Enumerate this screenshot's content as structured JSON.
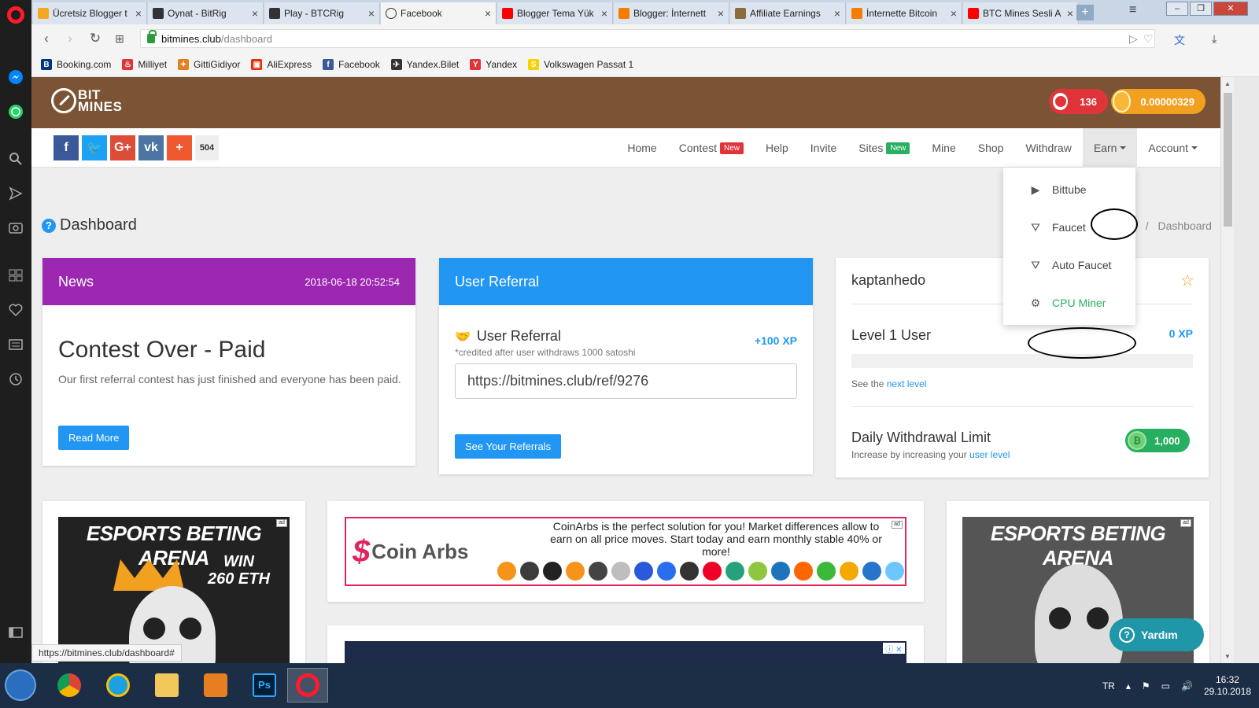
{
  "browser": {
    "tabs": [
      {
        "label": "Ücretsiz Blogger t",
        "color": "#f5a623"
      },
      {
        "label": "Oynat - BitRig",
        "color": "#333333"
      },
      {
        "label": "Play - BTCRig",
        "color": "#333333"
      },
      {
        "label": "Facebook",
        "color": "#ffffff"
      },
      {
        "label": "Blogger Tema Yük",
        "color": "#ff0000"
      },
      {
        "label": "Blogger: İnternett",
        "color": "#f57d00"
      },
      {
        "label": "Affiliate Earnings",
        "color": "#8a6d3b"
      },
      {
        "label": "İnternette Bitcoin",
        "color": "#f57d00"
      },
      {
        "label": "BTC Mines Sesli A",
        "color": "#ff0000"
      }
    ],
    "url_host": "bitmines.club",
    "url_path": "/dashboard",
    "bookmarks": [
      {
        "label": "Booking.com",
        "icon_text": "B",
        "color": "#003580"
      },
      {
        "label": "Milliyet",
        "icon_text": "♨",
        "color": "#e0343b"
      },
      {
        "label": "GittiGidiyor",
        "icon_text": "✦",
        "color": "#e67e22"
      },
      {
        "label": "AliExpress",
        "icon_text": "▣",
        "color": "#e62e04"
      },
      {
        "label": "Facebook",
        "icon_text": "f",
        "color": "#3b5998"
      },
      {
        "label": "Yandex.Bilet",
        "icon_text": "✈",
        "color": "#333333"
      },
      {
        "label": "Yandex",
        "icon_text": "Y",
        "color": "#e0343b"
      },
      {
        "label": "Volkswagen Passat 1",
        "icon_text": "S",
        "color": "#f7d100"
      }
    ],
    "status_url": "https://bitmines.club/dashboard#"
  },
  "site": {
    "logo_line1": "BIT",
    "logo_line2": "MINES",
    "energy": "136",
    "balance": "0.00000329",
    "share_count": "504",
    "social": [
      {
        "icon": "facebook-icon",
        "glyph": "f",
        "color": "#3b5998"
      },
      {
        "icon": "twitter-icon",
        "glyph": "🐦",
        "color": "#1da1f2"
      },
      {
        "icon": "google-plus-icon",
        "glyph": "G+",
        "color": "#dd4b39"
      },
      {
        "icon": "vk-icon",
        "glyph": "vk",
        "color": "#4c75a3"
      },
      {
        "icon": "share-plus-icon",
        "glyph": "+",
        "color": "#f0582f"
      }
    ],
    "nav": {
      "home": "Home",
      "contest": "Contest",
      "contest_badge": "New",
      "help": "Help",
      "invite": "Invite",
      "sites": "Sites",
      "sites_badge": "New",
      "mine": "Mine",
      "shop": "Shop",
      "withdraw": "Withdraw",
      "earn": "Earn",
      "account": "Account"
    },
    "earn_menu": [
      {
        "label": "Bittube",
        "icon": "play-icon",
        "glyph": "▶"
      },
      {
        "label": "Faucet",
        "icon": "faucet-icon",
        "glyph": "⛛"
      },
      {
        "label": "Auto Faucet",
        "icon": "auto-faucet-icon",
        "glyph": "⛛"
      },
      {
        "label": "CPU Miner",
        "icon": "gears-icon",
        "glyph": "⚙"
      }
    ],
    "page_title": "Dashboard",
    "breadcrumb_home": "e",
    "breadcrumb_sep": "/",
    "breadcrumb_current": "Dashboard"
  },
  "news": {
    "header": "News",
    "date": "2018-06-18 20:52:54",
    "title": "Contest Over - Paid",
    "text": "Our first referral contest has just finished and everyone has been paid.",
    "button": "Read More"
  },
  "referral": {
    "header": "User Referral",
    "title": "User Referral",
    "subtitle": "*credited after user withdraws 1000 satoshi",
    "xp": "+100 XP",
    "link": "https://bitmines.club/ref/9276",
    "button": "See Your Referrals"
  },
  "user": {
    "name": "kaptanhedo",
    "level": "Level 1 User",
    "xp": "0 XP",
    "progress": 0,
    "next_level_prefix": "See the",
    "next_level_link": "next level",
    "withdraw_title": "Daily Withdrawal Limit",
    "withdraw_prefix": "Increase by increasing your",
    "withdraw_link": "user level",
    "withdraw_limit": "1,000"
  },
  "ads": {
    "esports_title": "ESPORTS BETING ARENA",
    "esports_win1": "WIN",
    "esports_win2": "260 ETH",
    "coinarbs_name": "Coin Arbs",
    "coinarbs_text": "CoinArbs is the perfect solution for you! Market differences allow to earn on all price moves. Start today and earn monthly stable 40% or more!",
    "coin_colors": [
      "#f7931a",
      "#3c3c3d",
      "#222222",
      "#f7931a",
      "#444444",
      "#bebebe",
      "#2a5ada",
      "#2b6def",
      "#333333",
      "#ef0027",
      "#26a17b",
      "#8dc63f",
      "#1c75bc",
      "#ff6600",
      "#3ab83a",
      "#f2a900",
      "#2775ca",
      "#6ec6ff"
    ]
  },
  "help_widget": "Yardım",
  "taskbar": {
    "lang": "TR",
    "time": "16:32",
    "date": "29.10.2018"
  }
}
